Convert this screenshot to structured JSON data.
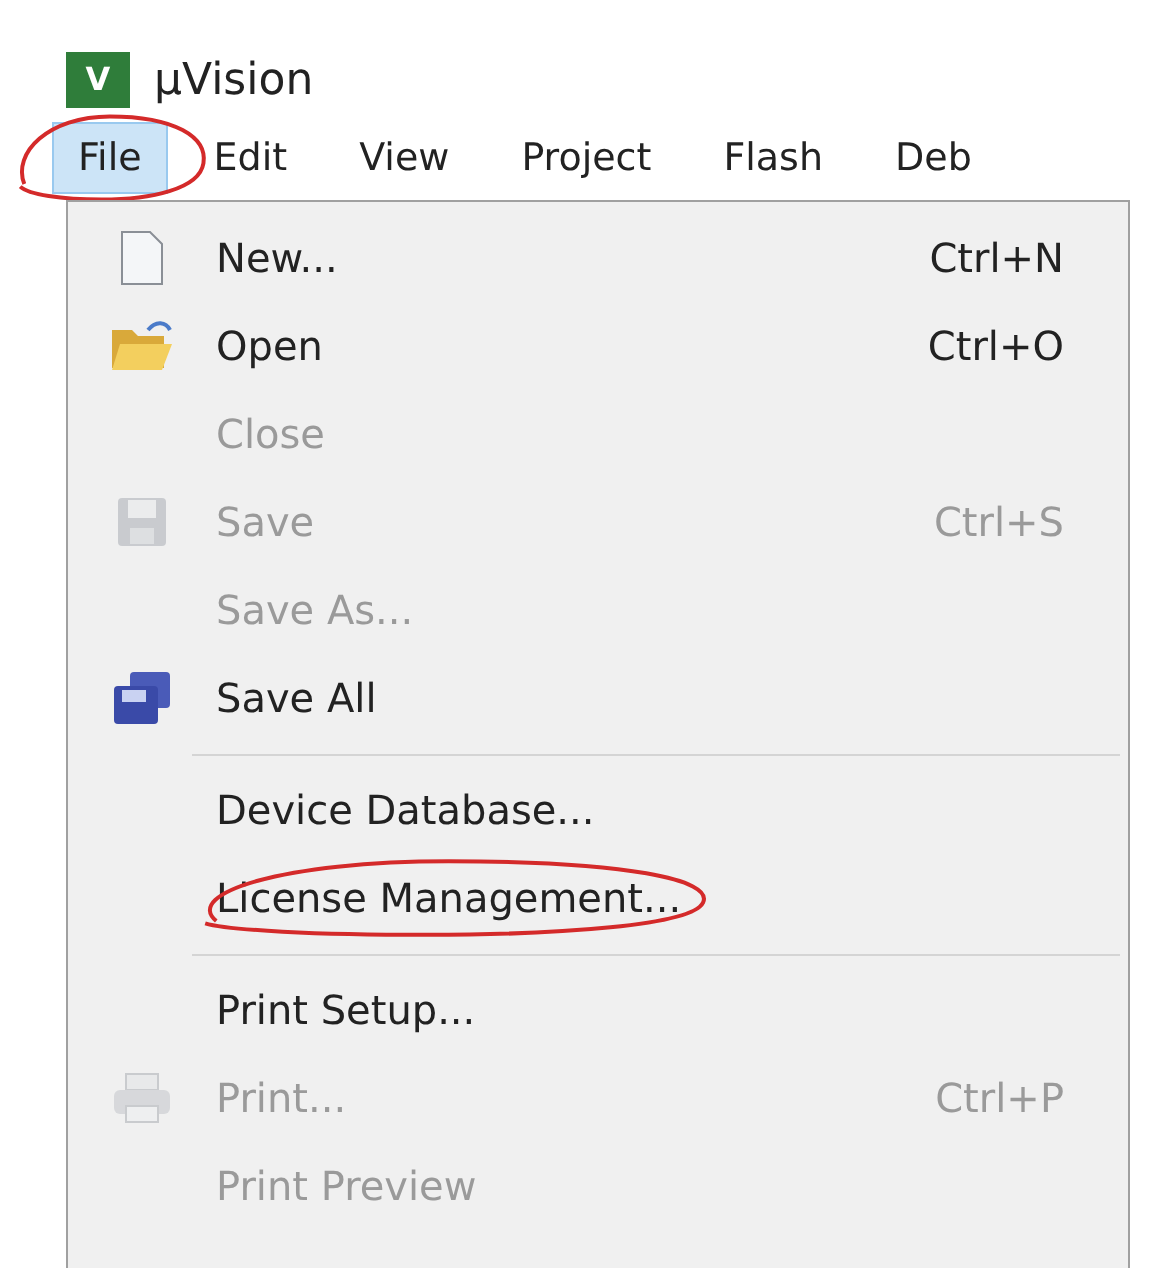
{
  "window": {
    "title": "µVision",
    "logo": "V"
  },
  "menu_bar": [
    {
      "label": "File",
      "selected": true,
      "circled": true
    },
    {
      "label": "Edit",
      "selected": false,
      "circled": false
    },
    {
      "label": "View",
      "selected": false,
      "circled": false
    },
    {
      "label": "Project",
      "selected": false,
      "circled": false
    },
    {
      "label": "Flash",
      "selected": false,
      "circled": false
    },
    {
      "label": "Deb",
      "selected": false,
      "circled": false
    }
  ],
  "file_menu": [
    {
      "kind": "item",
      "label": "New...",
      "shortcut": "Ctrl+N",
      "disabled": false,
      "circled": false
    },
    {
      "kind": "item",
      "label": "Open",
      "shortcut": "Ctrl+O",
      "disabled": false,
      "circled": false
    },
    {
      "kind": "item",
      "label": "Close",
      "disabled": true,
      "circled": false
    },
    {
      "kind": "item",
      "label": "Save",
      "shortcut": "Ctrl+S",
      "disabled": true,
      "circled": false
    },
    {
      "kind": "item",
      "label": "Save As...",
      "disabled": true,
      "circled": false
    },
    {
      "kind": "item",
      "label": "Save All",
      "disabled": false,
      "circled": false
    },
    {
      "kind": "separator"
    },
    {
      "kind": "item",
      "label": "Device Database...",
      "disabled": false,
      "circled": false
    },
    {
      "kind": "item",
      "label": "License Management...",
      "disabled": false,
      "circled": true
    },
    {
      "kind": "separator"
    },
    {
      "kind": "item",
      "label": "Print Setup...",
      "disabled": false,
      "circled": false
    },
    {
      "kind": "item",
      "label": "Print...",
      "shortcut": "Ctrl+P",
      "disabled": true,
      "circled": false
    },
    {
      "kind": "item",
      "label": "Print Preview",
      "disabled": true,
      "circled": false
    }
  ]
}
